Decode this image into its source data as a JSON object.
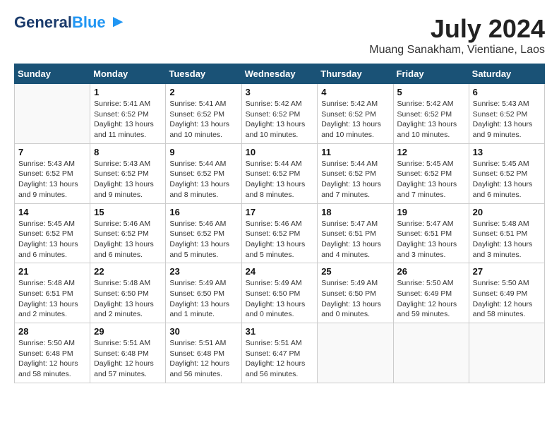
{
  "app": {
    "logo_line1": "General",
    "logo_line2": "Blue"
  },
  "header": {
    "month_title": "July 2024",
    "location": "Muang Sanakham, Vientiane, Laos"
  },
  "weekdays": [
    "Sunday",
    "Monday",
    "Tuesday",
    "Wednesday",
    "Thursday",
    "Friday",
    "Saturday"
  ],
  "weeks": [
    [
      {
        "day": "",
        "info": ""
      },
      {
        "day": "1",
        "info": "Sunrise: 5:41 AM\nSunset: 6:52 PM\nDaylight: 13 hours\nand 11 minutes."
      },
      {
        "day": "2",
        "info": "Sunrise: 5:41 AM\nSunset: 6:52 PM\nDaylight: 13 hours\nand 10 minutes."
      },
      {
        "day": "3",
        "info": "Sunrise: 5:42 AM\nSunset: 6:52 PM\nDaylight: 13 hours\nand 10 minutes."
      },
      {
        "day": "4",
        "info": "Sunrise: 5:42 AM\nSunset: 6:52 PM\nDaylight: 13 hours\nand 10 minutes."
      },
      {
        "day": "5",
        "info": "Sunrise: 5:42 AM\nSunset: 6:52 PM\nDaylight: 13 hours\nand 10 minutes."
      },
      {
        "day": "6",
        "info": "Sunrise: 5:43 AM\nSunset: 6:52 PM\nDaylight: 13 hours\nand 9 minutes."
      }
    ],
    [
      {
        "day": "7",
        "info": "Sunrise: 5:43 AM\nSunset: 6:52 PM\nDaylight: 13 hours\nand 9 minutes."
      },
      {
        "day": "8",
        "info": "Sunrise: 5:43 AM\nSunset: 6:52 PM\nDaylight: 13 hours\nand 9 minutes."
      },
      {
        "day": "9",
        "info": "Sunrise: 5:44 AM\nSunset: 6:52 PM\nDaylight: 13 hours\nand 8 minutes."
      },
      {
        "day": "10",
        "info": "Sunrise: 5:44 AM\nSunset: 6:52 PM\nDaylight: 13 hours\nand 8 minutes."
      },
      {
        "day": "11",
        "info": "Sunrise: 5:44 AM\nSunset: 6:52 PM\nDaylight: 13 hours\nand 7 minutes."
      },
      {
        "day": "12",
        "info": "Sunrise: 5:45 AM\nSunset: 6:52 PM\nDaylight: 13 hours\nand 7 minutes."
      },
      {
        "day": "13",
        "info": "Sunrise: 5:45 AM\nSunset: 6:52 PM\nDaylight: 13 hours\nand 6 minutes."
      }
    ],
    [
      {
        "day": "14",
        "info": "Sunrise: 5:45 AM\nSunset: 6:52 PM\nDaylight: 13 hours\nand 6 minutes."
      },
      {
        "day": "15",
        "info": "Sunrise: 5:46 AM\nSunset: 6:52 PM\nDaylight: 13 hours\nand 6 minutes."
      },
      {
        "day": "16",
        "info": "Sunrise: 5:46 AM\nSunset: 6:52 PM\nDaylight: 13 hours\nand 5 minutes."
      },
      {
        "day": "17",
        "info": "Sunrise: 5:46 AM\nSunset: 6:52 PM\nDaylight: 13 hours\nand 5 minutes."
      },
      {
        "day": "18",
        "info": "Sunrise: 5:47 AM\nSunset: 6:51 PM\nDaylight: 13 hours\nand 4 minutes."
      },
      {
        "day": "19",
        "info": "Sunrise: 5:47 AM\nSunset: 6:51 PM\nDaylight: 13 hours\nand 3 minutes."
      },
      {
        "day": "20",
        "info": "Sunrise: 5:48 AM\nSunset: 6:51 PM\nDaylight: 13 hours\nand 3 minutes."
      }
    ],
    [
      {
        "day": "21",
        "info": "Sunrise: 5:48 AM\nSunset: 6:51 PM\nDaylight: 13 hours\nand 2 minutes."
      },
      {
        "day": "22",
        "info": "Sunrise: 5:48 AM\nSunset: 6:50 PM\nDaylight: 13 hours\nand 2 minutes."
      },
      {
        "day": "23",
        "info": "Sunrise: 5:49 AM\nSunset: 6:50 PM\nDaylight: 13 hours\nand 1 minute."
      },
      {
        "day": "24",
        "info": "Sunrise: 5:49 AM\nSunset: 6:50 PM\nDaylight: 13 hours\nand 0 minutes."
      },
      {
        "day": "25",
        "info": "Sunrise: 5:49 AM\nSunset: 6:50 PM\nDaylight: 13 hours\nand 0 minutes."
      },
      {
        "day": "26",
        "info": "Sunrise: 5:50 AM\nSunset: 6:49 PM\nDaylight: 12 hours\nand 59 minutes."
      },
      {
        "day": "27",
        "info": "Sunrise: 5:50 AM\nSunset: 6:49 PM\nDaylight: 12 hours\nand 58 minutes."
      }
    ],
    [
      {
        "day": "28",
        "info": "Sunrise: 5:50 AM\nSunset: 6:48 PM\nDaylight: 12 hours\nand 58 minutes."
      },
      {
        "day": "29",
        "info": "Sunrise: 5:51 AM\nSunset: 6:48 PM\nDaylight: 12 hours\nand 57 minutes."
      },
      {
        "day": "30",
        "info": "Sunrise: 5:51 AM\nSunset: 6:48 PM\nDaylight: 12 hours\nand 56 minutes."
      },
      {
        "day": "31",
        "info": "Sunrise: 5:51 AM\nSunset: 6:47 PM\nDaylight: 12 hours\nand 56 minutes."
      },
      {
        "day": "",
        "info": ""
      },
      {
        "day": "",
        "info": ""
      },
      {
        "day": "",
        "info": ""
      }
    ]
  ]
}
